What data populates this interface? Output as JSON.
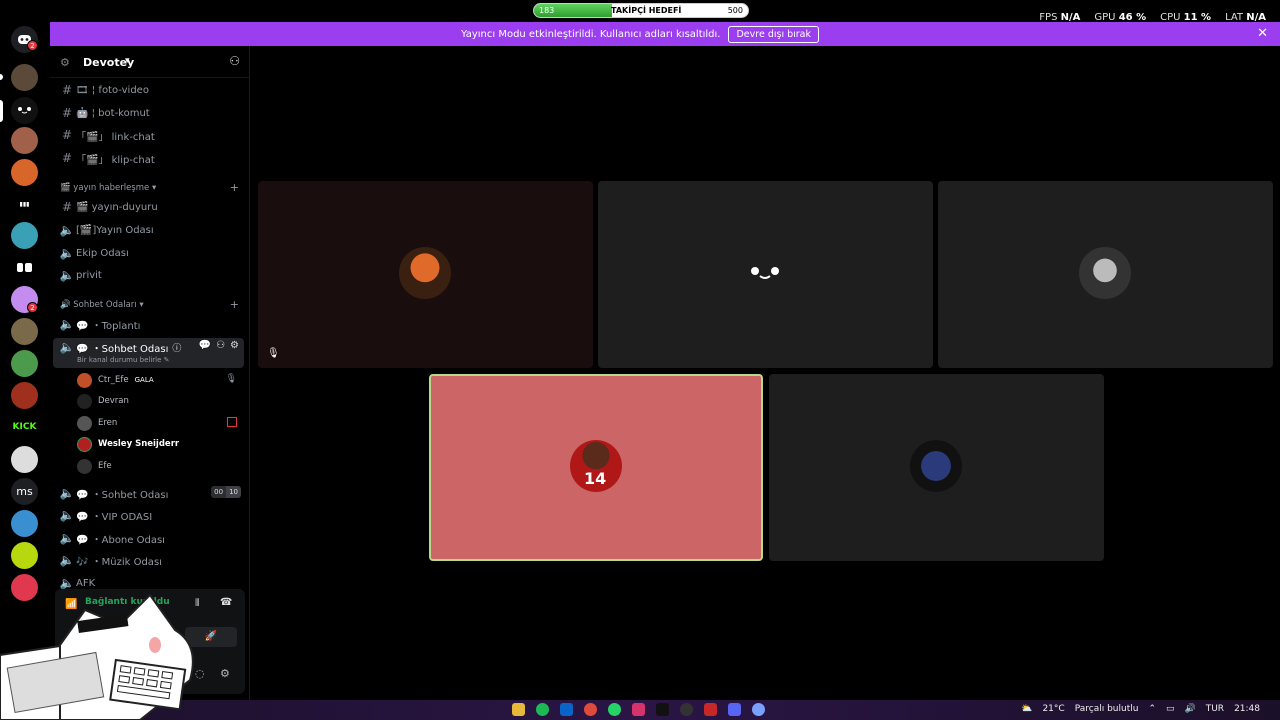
{
  "overlay": {
    "follow_current": "183",
    "follow_label": "TAKİPÇİ HEDEFİ",
    "follow_goal": "500",
    "follow_progress": 0.366,
    "stats": [
      {
        "label": "FPS",
        "value": "N/A"
      },
      {
        "label": "GPU",
        "value": "46 %"
      },
      {
        "label": "CPU",
        "value": "11 %"
      },
      {
        "label": "LAT",
        "value": "N/A"
      }
    ]
  },
  "banner": {
    "message": "Yayıncı Modu etkinleştirildi. Kullanıcı adları kısaltıldı.",
    "button": "Devre dışı bırak"
  },
  "rail": {
    "badges": [
      "2",
      "2"
    ],
    "labels": [
      "ms",
      "KICK"
    ]
  },
  "server": {
    "name": "Devotey"
  },
  "channels_top": [
    {
      "icon": "#",
      "label": "🎞 ¦ foto-video"
    },
    {
      "icon": "#",
      "label": "🤖 ¦ bot-komut"
    },
    {
      "icon": "#",
      "label": "「🎬」 link-chat"
    },
    {
      "icon": "#",
      "label": "「🎬」 klip-chat"
    }
  ],
  "category_yayin": "🎬 yayın haberleşme",
  "channels_yayin": [
    {
      "label": "🎬 yayın-duyuru"
    },
    {
      "label": "[🎬]Yayın Odası"
    },
    {
      "label": "Ekip Odası"
    },
    {
      "label": "privit"
    }
  ],
  "category_sohbet": "🔊 Sohbet Odaları",
  "channels_sohbet": [
    {
      "label": "💬 ・Toplantı"
    },
    {
      "label": "💬 ・Sohbet Odası"
    }
  ],
  "active_channel": {
    "status": "Bir kanal durumu belirle"
  },
  "voice_users": [
    {
      "name": "Ctr_Efe",
      "tag": "GALA"
    },
    {
      "name": "Devran",
      "tag": ""
    },
    {
      "name": "Eren",
      "tag": ""
    },
    {
      "name": "Wesley Sneijderr",
      "tag": ""
    },
    {
      "name": "Efe",
      "tag": ""
    }
  ],
  "channels_bottom": [
    {
      "label": "💬 ・Sohbet Odası"
    },
    {
      "label": "💬 ・VIP ODASI"
    },
    {
      "label": "💬 ・Abone Odası"
    },
    {
      "label": "🎶 ・Müzik Odası"
    },
    {
      "label": "AFK"
    }
  ],
  "sohbet2_counts": {
    "current": "00",
    "limit": "10"
  },
  "voice_status": "Bağlantı kuruldu",
  "taskbar": {
    "weather_temp": "21°C",
    "weather_text": "Parçalı bulutlu",
    "lang": "TUR",
    "time": "21:48"
  },
  "colors": {
    "banner": "#9b3ef0",
    "speaking_tile": "#cc6666",
    "accent": "#5865f2"
  }
}
